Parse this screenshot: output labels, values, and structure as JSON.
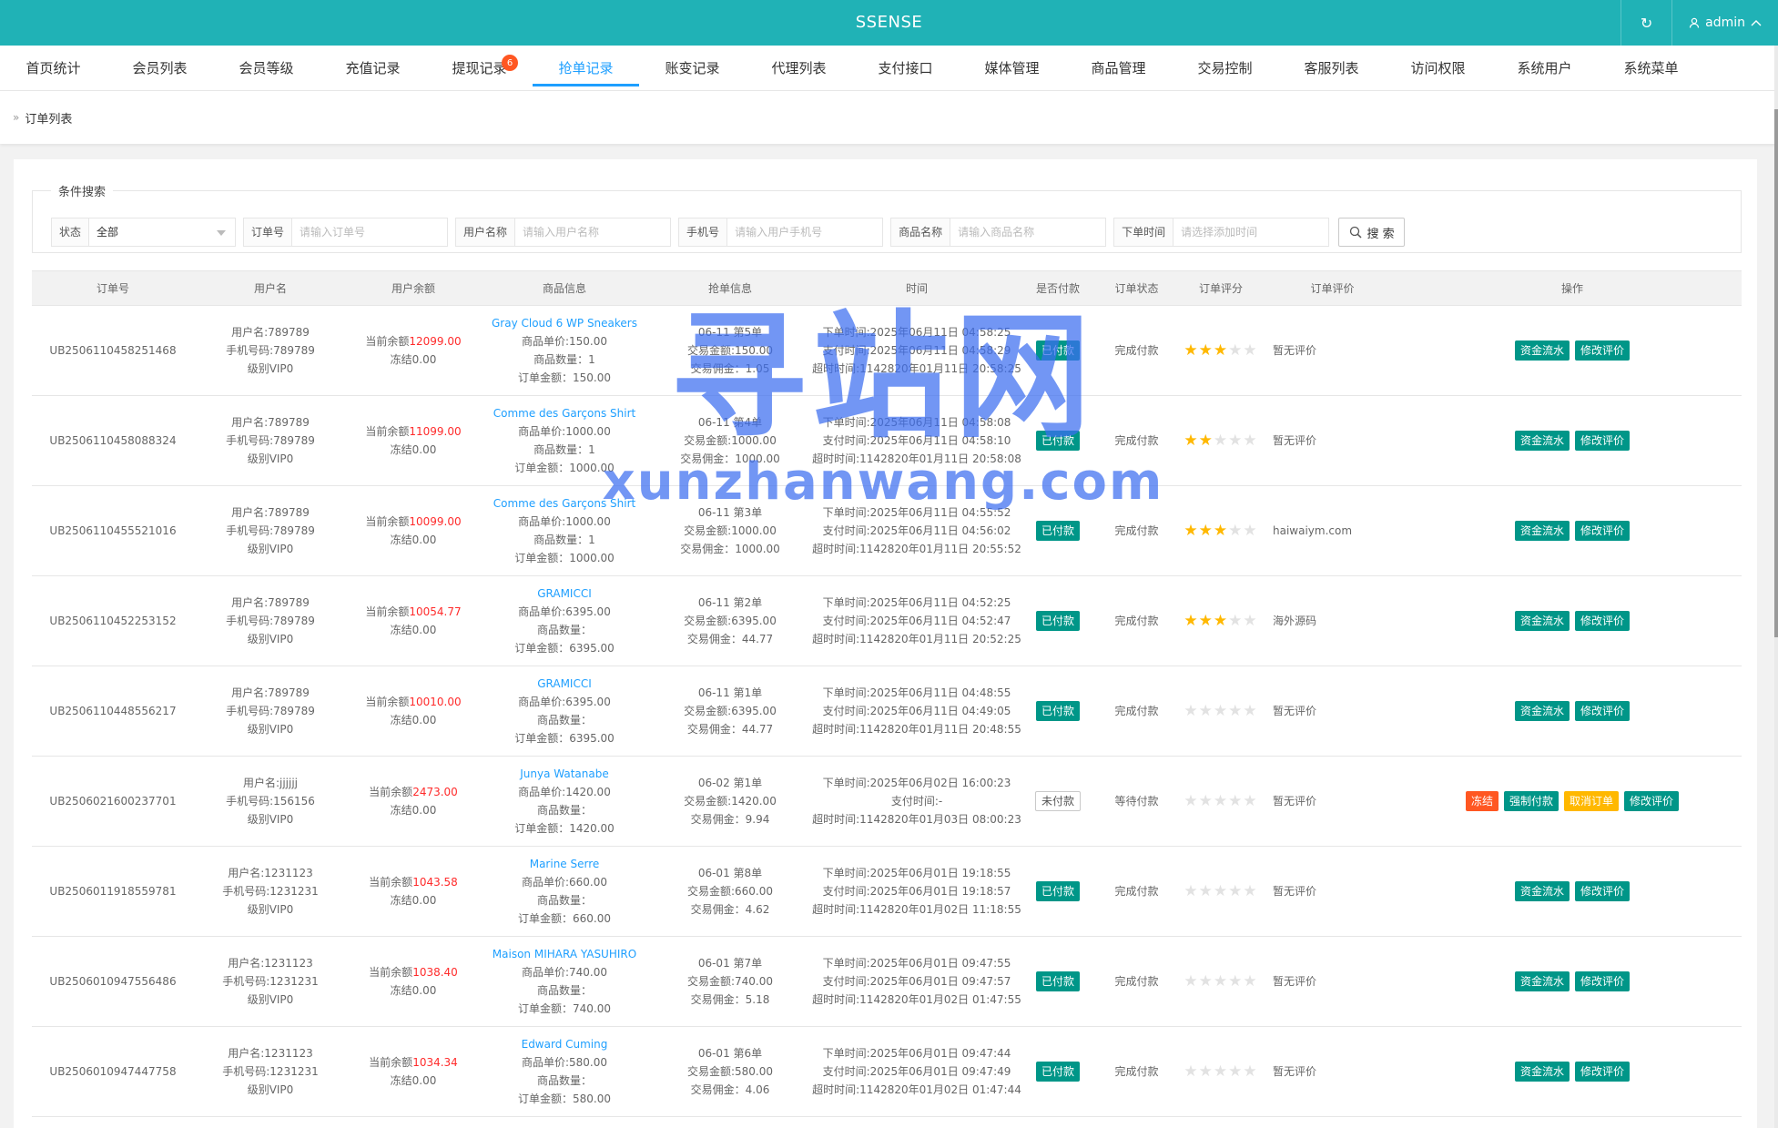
{
  "topbar": {
    "title": "SSENSE",
    "refresh_icon": "↻",
    "user": "admin"
  },
  "nav": [
    {
      "label": "首页统计"
    },
    {
      "label": "会员列表"
    },
    {
      "label": "会员等级"
    },
    {
      "label": "充值记录"
    },
    {
      "label": "提现记录",
      "badge": "6"
    },
    {
      "label": "抢单记录",
      "active": true
    },
    {
      "label": "账变记录"
    },
    {
      "label": "代理列表"
    },
    {
      "label": "支付接口"
    },
    {
      "label": "媒体管理"
    },
    {
      "label": "商品管理"
    },
    {
      "label": "交易控制"
    },
    {
      "label": "客服列表"
    },
    {
      "label": "访问权限"
    },
    {
      "label": "系统用户"
    },
    {
      "label": "系统菜单"
    }
  ],
  "breadcrumb": {
    "arrow": "»",
    "label": "订单列表"
  },
  "search": {
    "legend": "条件搜索",
    "status_label": "状态",
    "status_value": "全部",
    "order_label": "订单号",
    "order_placeholder": "请输入订单号",
    "user_label": "用户名称",
    "user_placeholder": "请输入用户名称",
    "phone_label": "手机号",
    "phone_placeholder": "请输入用户手机号",
    "product_label": "商品名称",
    "product_placeholder": "请输入商品名称",
    "time_label": "下单时间",
    "time_placeholder": "请选择添加时间",
    "button": "搜 索"
  },
  "table": {
    "headers": [
      "订单号",
      "用户名",
      "用户余额",
      "商品信息",
      "抢单信息",
      "时间",
      "是否付款",
      "订单状态",
      "订单评分",
      "订单评价",
      "操作"
    ],
    "rows": [
      {
        "order": "UB2506110458251468",
        "user": "用户名:789789",
        "phone": "手机号码:789789",
        "level": "级别VIP0",
        "bal_label": "当前余额",
        "bal": "12099.00",
        "frozen": "冻结0.00",
        "pname": "Gray Cloud 6 WP Sneakers",
        "price": "商品单价:150.00",
        "qty": "商品数量：1",
        "amount": "订单金额：150.00",
        "grab": "06-11 第5单",
        "trade": "交易金额:150.00",
        "comm": "交易佣金：1.05",
        "t1": "下单时间:2025年06月11日 04:58:25",
        "t2": "支付时间:2025年06月11日 04:58:29",
        "t3": "超时时间:1142820年01月11日 20:58:25",
        "paid": "已付款",
        "paid_flag": true,
        "state": "完成付款",
        "stars": 3,
        "review": "暂无评价",
        "ops": [
          "资金流水",
          "修改评价"
        ]
      },
      {
        "order": "UB2506110458088324",
        "user": "用户名:789789",
        "phone": "手机号码:789789",
        "level": "级别VIP0",
        "bal_label": "当前余额",
        "bal": "11099.00",
        "frozen": "冻结0.00",
        "pname": "Comme des Garçons Shirt",
        "price": "商品单价:1000.00",
        "qty": "商品数量：1",
        "amount": "订单金额：1000.00",
        "grab": "06-11 第4单",
        "trade": "交易金额:1000.00",
        "comm": "交易佣金：1000.00",
        "t1": "下单时间:2025年06月11日 04:58:08",
        "t2": "支付时间:2025年06月11日 04:58:10",
        "t3": "超时时间:1142820年01月11日 20:58:08",
        "paid": "已付款",
        "paid_flag": true,
        "state": "完成付款",
        "stars": 2,
        "review": "暂无评价",
        "ops": [
          "资金流水",
          "修改评价"
        ]
      },
      {
        "order": "UB2506110455521016",
        "user": "用户名:789789",
        "phone": "手机号码:789789",
        "level": "级别VIP0",
        "bal_label": "当前余额",
        "bal": "10099.00",
        "frozen": "冻结0.00",
        "pname": "Comme des Garçons Shirt",
        "price": "商品单价:1000.00",
        "qty": "商品数量：1",
        "amount": "订单金额：1000.00",
        "grab": "06-11 第3单",
        "trade": "交易金额:1000.00",
        "comm": "交易佣金：1000.00",
        "t1": "下单时间:2025年06月11日 04:55:52",
        "t2": "支付时间:2025年06月11日 04:56:02",
        "t3": "超时时间:1142820年01月11日 20:55:52",
        "paid": "已付款",
        "paid_flag": true,
        "state": "完成付款",
        "stars": 3,
        "review": "haiwaiym.com",
        "ops": [
          "资金流水",
          "修改评价"
        ]
      },
      {
        "order": "UB2506110452253152",
        "user": "用户名:789789",
        "phone": "手机号码:789789",
        "level": "级别VIP0",
        "bal_label": "当前余额",
        "bal": "10054.77",
        "frozen": "冻结0.00",
        "pname": "GRAMICCI",
        "price": "商品单价:6395.00",
        "qty": "商品数量：",
        "amount": "订单金额：6395.00",
        "grab": "06-11 第2单",
        "trade": "交易金额:6395.00",
        "comm": "交易佣金：44.77",
        "t1": "下单时间:2025年06月11日 04:52:25",
        "t2": "支付时间:2025年06月11日 04:52:47",
        "t3": "超时时间:1142820年01月11日 20:52:25",
        "paid": "已付款",
        "paid_flag": true,
        "state": "完成付款",
        "stars": 3,
        "review": "海外源码",
        "ops": [
          "资金流水",
          "修改评价"
        ]
      },
      {
        "order": "UB2506110448556217",
        "user": "用户名:789789",
        "phone": "手机号码:789789",
        "level": "级别VIP0",
        "bal_label": "当前余额",
        "bal": "10010.00",
        "frozen": "冻结0.00",
        "pname": "GRAMICCI",
        "price": "商品单价:6395.00",
        "qty": "商品数量：",
        "amount": "订单金额：6395.00",
        "grab": "06-11 第1单",
        "trade": "交易金额:6395.00",
        "comm": "交易佣金：44.77",
        "t1": "下单时间:2025年06月11日 04:48:55",
        "t2": "支付时间:2025年06月11日 04:49:05",
        "t3": "超时时间:1142820年01月11日 20:48:55",
        "paid": "已付款",
        "paid_flag": true,
        "state": "完成付款",
        "stars": 0,
        "review": "暂无评价",
        "ops": [
          "资金流水",
          "修改评价"
        ]
      },
      {
        "order": "UB2506021600237701",
        "user": "用户名:jjjjjj",
        "phone": "手机号码:156156",
        "level": "级别VIP0",
        "bal_label": "当前余额",
        "bal": "2473.00",
        "frozen": "冻结0.00",
        "pname": "Junya Watanabe",
        "price": "商品单价:1420.00",
        "qty": "商品数量：",
        "amount": "订单金额：1420.00",
        "grab": "06-02 第1单",
        "trade": "交易金额:1420.00",
        "comm": "交易佣金：9.94",
        "t1": "下单时间:2025年06月02日 16:00:23",
        "t2": "支付时间:-",
        "t3": "超时时间:1142820年01月03日 08:00:23",
        "paid": "未付款",
        "paid_flag": false,
        "state": "等待付款",
        "stars": 0,
        "review": "暂无评价",
        "ops": [
          "冻结",
          "强制付款",
          "取消订单",
          "修改评价"
        ]
      },
      {
        "order": "UB2506011918559781",
        "user": "用户名:1231123",
        "phone": "手机号码:1231231",
        "level": "级别VIP0",
        "bal_label": "当前余额",
        "bal": "1043.58",
        "frozen": "冻结0.00",
        "pname": "Marine Serre",
        "price": "商品单价:660.00",
        "qty": "商品数量：",
        "amount": "订单金额：660.00",
        "grab": "06-01 第8单",
        "trade": "交易金额:660.00",
        "comm": "交易佣金：4.62",
        "t1": "下单时间:2025年06月01日 19:18:55",
        "t2": "支付时间:2025年06月01日 19:18:57",
        "t3": "超时时间:1142820年01月02日 11:18:55",
        "paid": "已付款",
        "paid_flag": true,
        "state": "完成付款",
        "stars": 0,
        "review": "暂无评价",
        "ops": [
          "资金流水",
          "修改评价"
        ]
      },
      {
        "order": "UB2506010947556486",
        "user": "用户名:1231123",
        "phone": "手机号码:1231231",
        "level": "级别VIP0",
        "bal_label": "当前余额",
        "bal": "1038.40",
        "frozen": "冻结0.00",
        "pname": "Maison MIHARA YASUHIRO",
        "price": "商品单价:740.00",
        "qty": "商品数量：",
        "amount": "订单金额：740.00",
        "grab": "06-01 第7单",
        "trade": "交易金额:740.00",
        "comm": "交易佣金：5.18",
        "t1": "下单时间:2025年06月01日 09:47:55",
        "t2": "支付时间:2025年06月01日 09:47:57",
        "t3": "超时时间:1142820年01月02日 01:47:55",
        "paid": "已付款",
        "paid_flag": true,
        "state": "完成付款",
        "stars": 0,
        "review": "暂无评价",
        "ops": [
          "资金流水",
          "修改评价"
        ]
      },
      {
        "order": "UB2506010947447758",
        "user": "用户名:1231123",
        "phone": "手机号码:1231231",
        "level": "级别VIP0",
        "bal_label": "当前余额",
        "bal": "1034.34",
        "frozen": "冻结0.00",
        "pname": "Edward Cuming",
        "price": "商品单价:580.00",
        "qty": "商品数量：",
        "amount": "订单金额：580.00",
        "grab": "06-01 第6单",
        "trade": "交易金额:580.00",
        "comm": "交易佣金：4.06",
        "t1": "下单时间:2025年06月01日 09:47:44",
        "t2": "支付时间:2025年06月01日 09:47:49",
        "t3": "超时时间:1142820年01月02日 01:47:44",
        "paid": "已付款",
        "paid_flag": true,
        "state": "完成付款",
        "stars": 0,
        "review": "暂无评价",
        "ops": [
          "资金流水",
          "修改评价"
        ]
      }
    ]
  },
  "watermark": {
    "cn": "寻站网",
    "en": "xunzhanwang.com"
  },
  "colors": {
    "topbar": "#20b2b6",
    "accent": "#1e9fff",
    "paid": "#009688",
    "danger": "#ff5722",
    "warn": "#ffb800",
    "balance": "#ff2b2b"
  }
}
